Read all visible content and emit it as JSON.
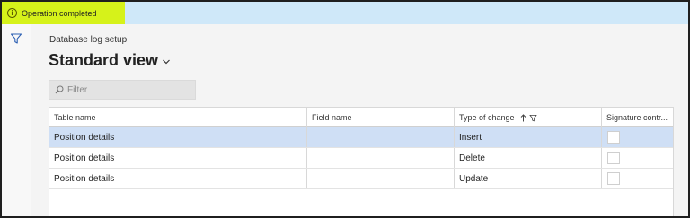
{
  "message_bar": {
    "text": "Operation completed",
    "info_icon_glyph": "i",
    "highlight_color": "#d6f21a",
    "bar_color": "#cfe8f9"
  },
  "left_rail": {
    "filter_icon": "filter-icon"
  },
  "page": {
    "breadcrumb": "Database log setup",
    "view_title": "Standard view"
  },
  "search": {
    "placeholder": "Filter",
    "value": ""
  },
  "grid": {
    "columns": [
      "Table name",
      "Field name",
      "Type of change",
      "Signature contr..."
    ],
    "sort_column": "Type of change",
    "rows": [
      {
        "table_name": "Position details",
        "field_name": "",
        "type_of_change": "Insert",
        "signature": false,
        "selected": true
      },
      {
        "table_name": "Position details",
        "field_name": "",
        "type_of_change": "Delete",
        "signature": false,
        "selected": false
      },
      {
        "table_name": "Position details",
        "field_name": "",
        "type_of_change": "Update",
        "signature": false,
        "selected": false
      }
    ],
    "selected_row_color": "#cfdff5"
  }
}
